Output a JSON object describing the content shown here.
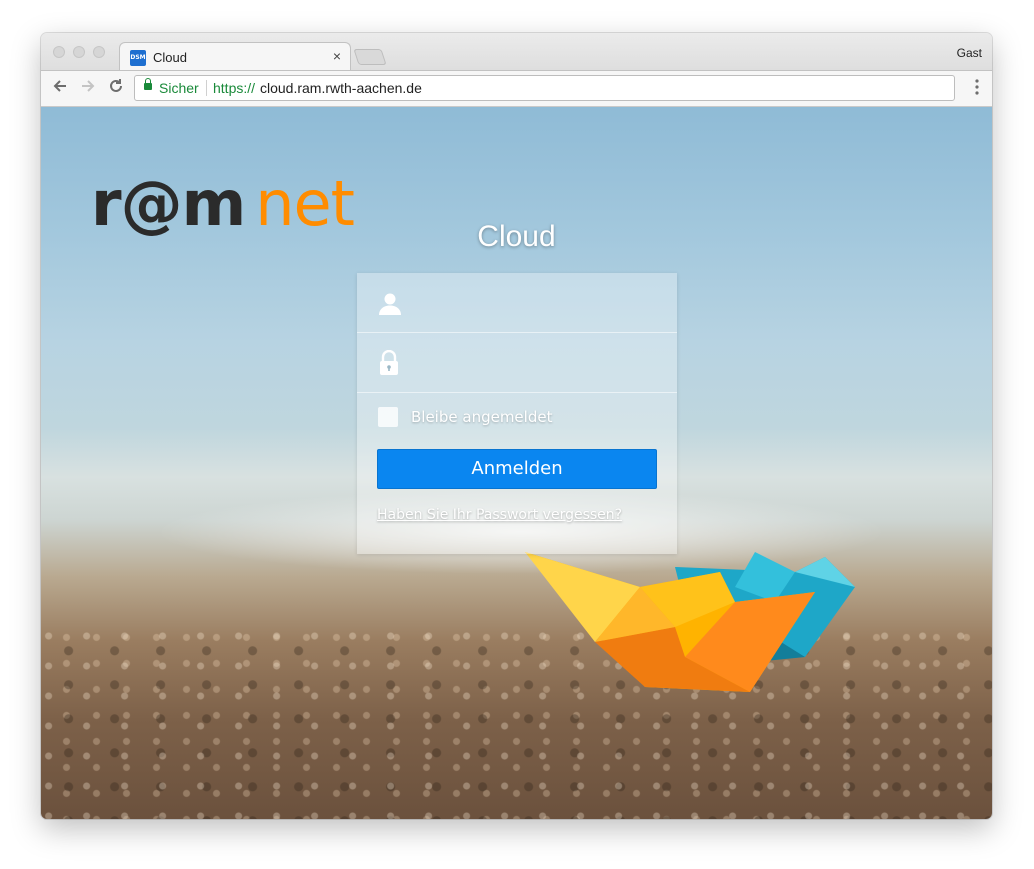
{
  "browser": {
    "tab": {
      "favicon_text": "DSM",
      "title": "Cloud",
      "close_symbol": "×"
    },
    "profile": "Gast",
    "address_bar": {
      "security_label": "Sicher",
      "url_scheme": "https://",
      "url_host": "cloud.ram.rwth-aachen.de"
    }
  },
  "page": {
    "logo": {
      "part1": "r@m",
      "part2": "net"
    },
    "login_title": "Cloud",
    "login_form": {
      "username_value": "",
      "password_value": "",
      "remember_label": "Bleibe angemeldet",
      "remember_checked": false,
      "submit_label": "Anmelden",
      "forgot_password_link": "Haben Sie Ihr Passwort vergessen?"
    }
  },
  "colors": {
    "button_blue": "#0a86f0",
    "secure_green": "#1a8a3a",
    "logo_orange": "#ff8c00",
    "logo_dark": "#2b2b2b"
  }
}
